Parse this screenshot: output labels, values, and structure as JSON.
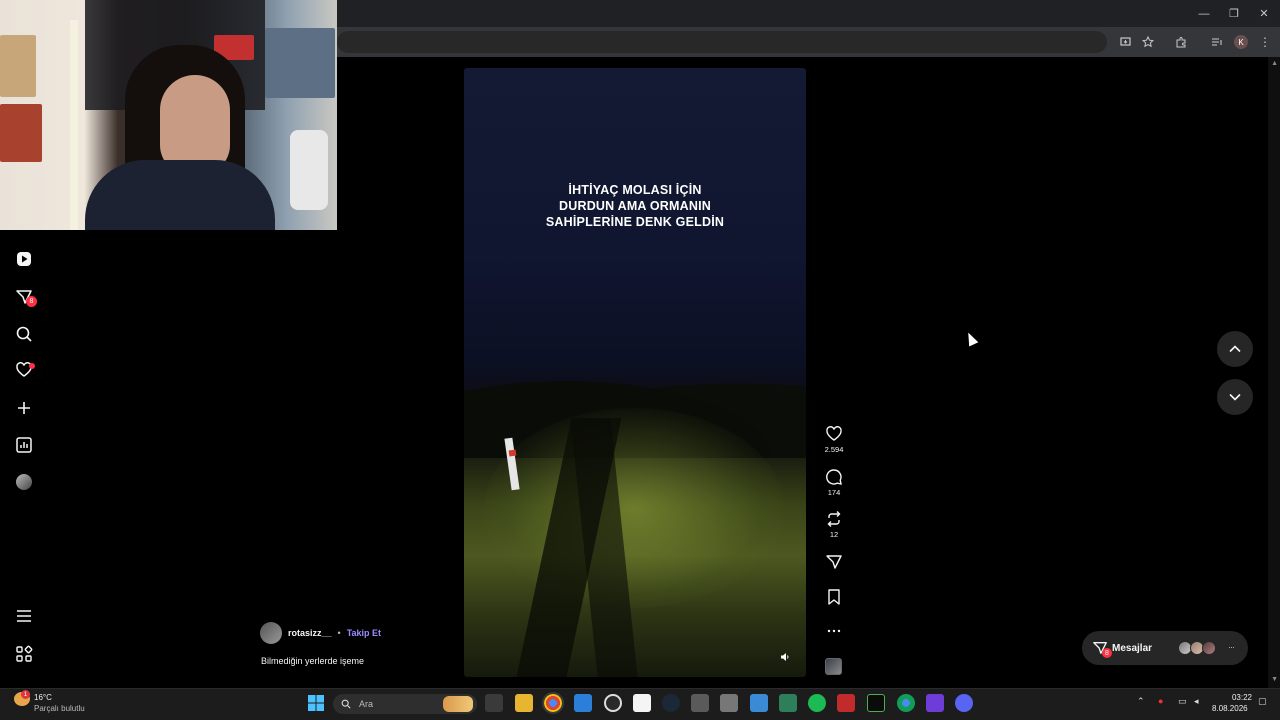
{
  "window": {
    "minimize_glyph": "—",
    "maximize_glyph": "❐",
    "close_glyph": "✕"
  },
  "browser": {
    "profile_initial": "K",
    "menu_glyph": "⋮"
  },
  "video": {
    "overlay_lines": [
      "İHTİYAÇ MOLASI İÇİN",
      "DURDUN AMA ORMANIN",
      "SAHİPLERİNE DENK GELDİN"
    ]
  },
  "left_nav": {
    "messages_badge": "8"
  },
  "actions": {
    "likes": "2.594",
    "comments": "174",
    "reposts": "12"
  },
  "author": {
    "username": "rotasizz__",
    "separator": "•",
    "follow_label": "Takip Et",
    "caption": "Bilmediğin yerlerde işeme"
  },
  "messages": {
    "label": "Mesajlar",
    "badge": "8",
    "more": "···"
  },
  "taskbar": {
    "weather_badge": "1",
    "temperature": "16°C",
    "condition": "Parçalı bulutlu",
    "search_placeholder": "Ara",
    "time": "03:22",
    "date": "8.08.2026"
  },
  "colors": {
    "accent_follow": "#9b8cff",
    "badge": "#ff3040",
    "pill_bg": "#262626"
  }
}
